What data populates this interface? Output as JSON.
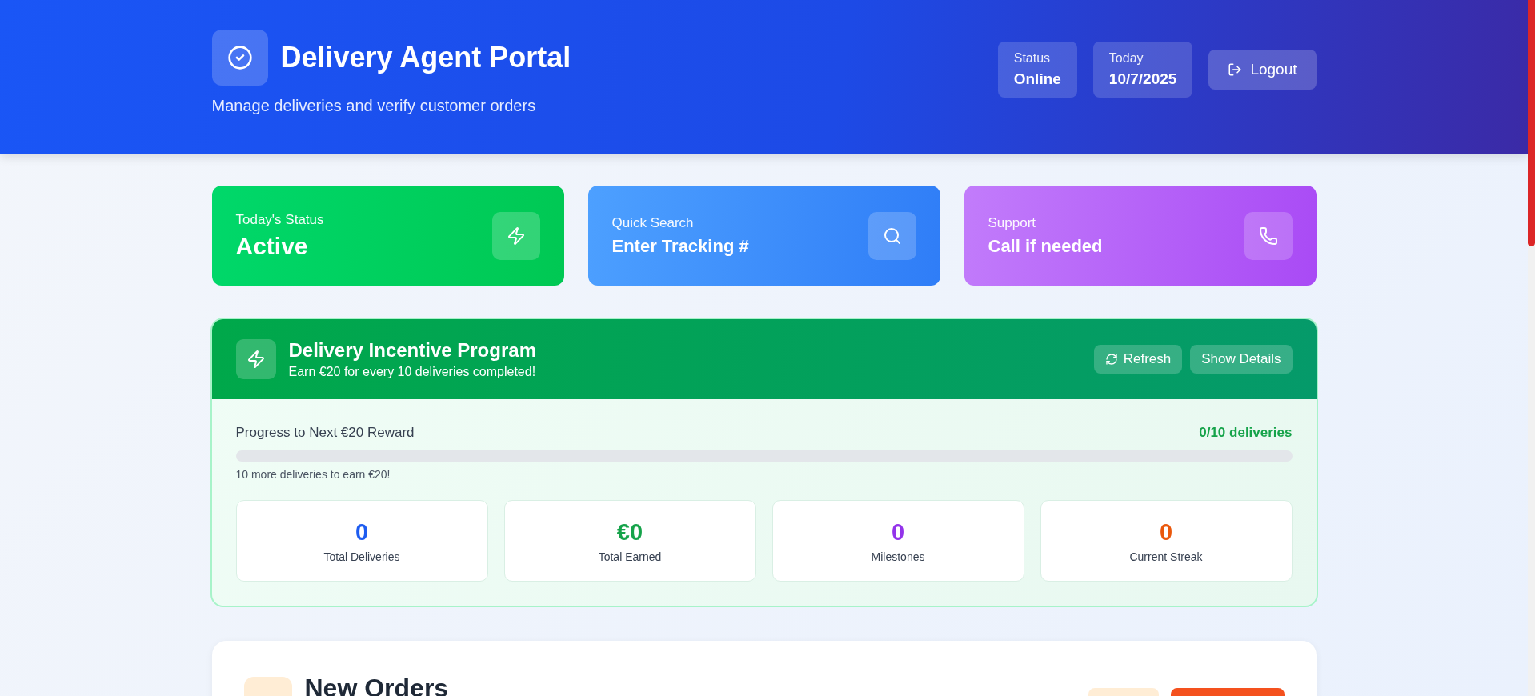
{
  "header": {
    "title": "Delivery Agent Portal",
    "subtitle": "Manage deliveries and verify customer orders",
    "pills": [
      {
        "label": "Status",
        "value": "Online"
      },
      {
        "label": "Today",
        "value": "10/7/2025"
      }
    ],
    "logout": "Logout"
  },
  "quick_cards": [
    {
      "kind": "status",
      "label": "Today's Status",
      "value": "Active"
    },
    {
      "kind": "search",
      "label": "Quick Search",
      "value": "Enter Tracking #"
    },
    {
      "kind": "support",
      "label": "Support",
      "value": "Call if needed"
    }
  ],
  "incentive": {
    "title": "Delivery Incentive Program",
    "subtitle": "Earn €20 for every 10 deliveries completed!",
    "buttons": [
      {
        "kind": "refresh",
        "label": "Refresh"
      },
      {
        "kind": "plain",
        "label": "Show Details"
      }
    ],
    "progress": {
      "label": "Progress to Next €20 Reward",
      "reading": "0/10 deliveries",
      "level": 0,
      "hint": "10 more deliveries to earn €20!"
    },
    "stats": [
      {
        "value": "0",
        "label": "Total Deliveries",
        "color": "#1d5cf0"
      },
      {
        "value": "€0",
        "label": "Total Earned",
        "color": "#16a34a"
      },
      {
        "value": "0",
        "label": "Milestones",
        "color": "#9333ea"
      },
      {
        "value": "0",
        "label": "Current Streak",
        "color": "#ea580c"
      }
    ]
  },
  "orders": {
    "title": "New Orders"
  }
}
